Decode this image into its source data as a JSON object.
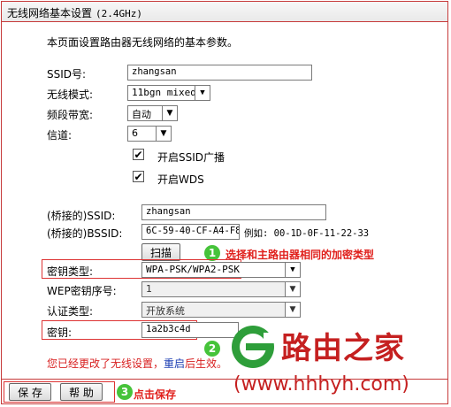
{
  "header": {
    "title": "无线网络基本设置",
    "band": "(2.4GHz)"
  },
  "description": "本页面设置路由器无线网络的基本参数。",
  "fields": {
    "ssid_label": "SSID号:",
    "ssid_value": "zhangsan",
    "mode_label": "无线模式:",
    "mode_value": "11bgn mixed",
    "bandwidth_label": "频段带宽:",
    "bandwidth_value": "自动",
    "channel_label": "信道:",
    "channel_value": "6",
    "enable_ssid_broadcast": "开启SSID广播",
    "enable_wds": "开启WDS",
    "bridge_ssid_label": "(桥接的)SSID:",
    "bridge_ssid_value": "zhangsan",
    "bridge_bssid_label": "(桥接的)BSSID:",
    "bridge_bssid_value": "6C-59-40-CF-A4-F8",
    "bssid_example": "例如: 00-1D-0F-11-22-33",
    "scan_button": "扫描",
    "key_type_label": "密钥类型:",
    "key_type_value": "WPA-PSK/WPA2-PSK",
    "wep_index_label": "WEP密钥序号:",
    "wep_index_value": "1",
    "auth_type_label": "认证类型:",
    "auth_type_value": "开放系统",
    "key_label": "密钥:",
    "key_value": "1a2b3c4d"
  },
  "annotations": {
    "step1_num": "1",
    "step1_text": "选择和主路由器相同的加密类型",
    "step2_num": "2",
    "step3_num": "3",
    "step3_text": "点击保存"
  },
  "notice": {
    "text": "您已经更改了无线设置，",
    "link": "重启",
    "tail": "后生效。"
  },
  "buttons": {
    "save": "保 存",
    "help": "帮 助"
  },
  "watermark": {
    "brand": "路由之家",
    "url": "(www.hhhyh.com)"
  },
  "colors": {
    "border": "#c63a3a",
    "annotation": "#e0201c",
    "badge": "#46c33a",
    "watermark_green": "#2e9e3a",
    "watermark_red": "#c52020"
  }
}
